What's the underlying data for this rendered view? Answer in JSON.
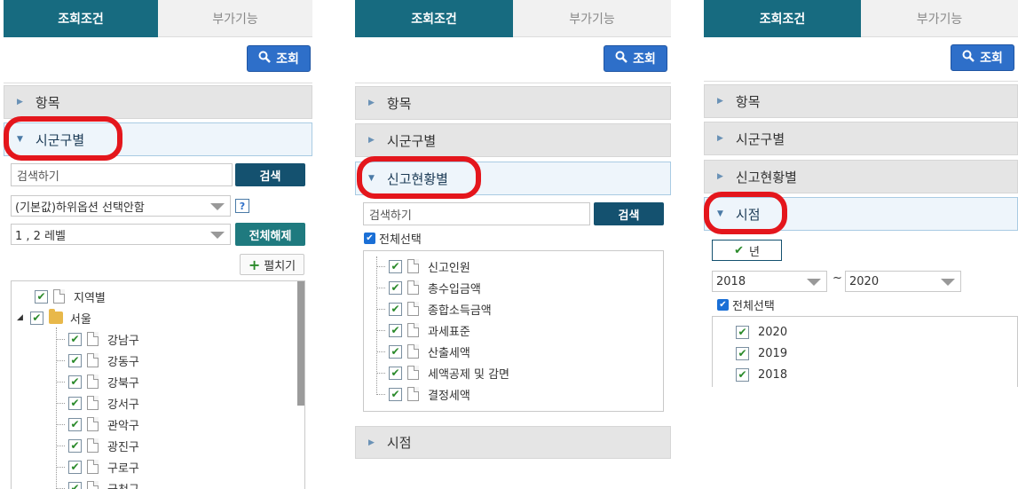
{
  "tabs": {
    "active": "조회조건",
    "inactive": "부가기능"
  },
  "search_button": "조회",
  "sections": {
    "item": "항목",
    "region": "시군구별",
    "report": "신고현황별",
    "time": "시점"
  },
  "panel1": {
    "search_placeholder": "검색하기",
    "search_btn": "검색",
    "option_select": "(기본값)하위옵션 선택안함",
    "help": "?",
    "level_select": "1 , 2 레벨",
    "clear_all": "전체해제",
    "expand": "펼치기",
    "tree": [
      {
        "label": "지역별",
        "level": 0,
        "type": "doc"
      },
      {
        "label": "서울",
        "level": 0,
        "type": "folder"
      },
      {
        "label": "강남구",
        "level": 1,
        "type": "doc"
      },
      {
        "label": "강동구",
        "level": 1,
        "type": "doc"
      },
      {
        "label": "강북구",
        "level": 1,
        "type": "doc"
      },
      {
        "label": "강서구",
        "level": 1,
        "type": "doc"
      },
      {
        "label": "관악구",
        "level": 1,
        "type": "doc"
      },
      {
        "label": "광진구",
        "level": 1,
        "type": "doc"
      },
      {
        "label": "구로구",
        "level": 1,
        "type": "doc"
      },
      {
        "label": "금천구",
        "level": 1,
        "type": "doc"
      }
    ]
  },
  "panel2": {
    "search_placeholder": "검색하기",
    "search_btn": "검색",
    "select_all": "전체선택",
    "items": [
      "신고인원",
      "총수입금액",
      "종합소득금액",
      "과세표준",
      "산출세액",
      "세액공제 및 감면",
      "결정세액"
    ]
  },
  "panel3": {
    "year_btn": "년",
    "from_year": "2018",
    "tilde": "~",
    "to_year": "2020",
    "select_all": "전체선택",
    "years": [
      "2020",
      "2019",
      "2018"
    ]
  },
  "colors": {
    "tab_active": "#176b80",
    "search_btn": "#2e6fc9",
    "highlight": "#e4161c"
  }
}
